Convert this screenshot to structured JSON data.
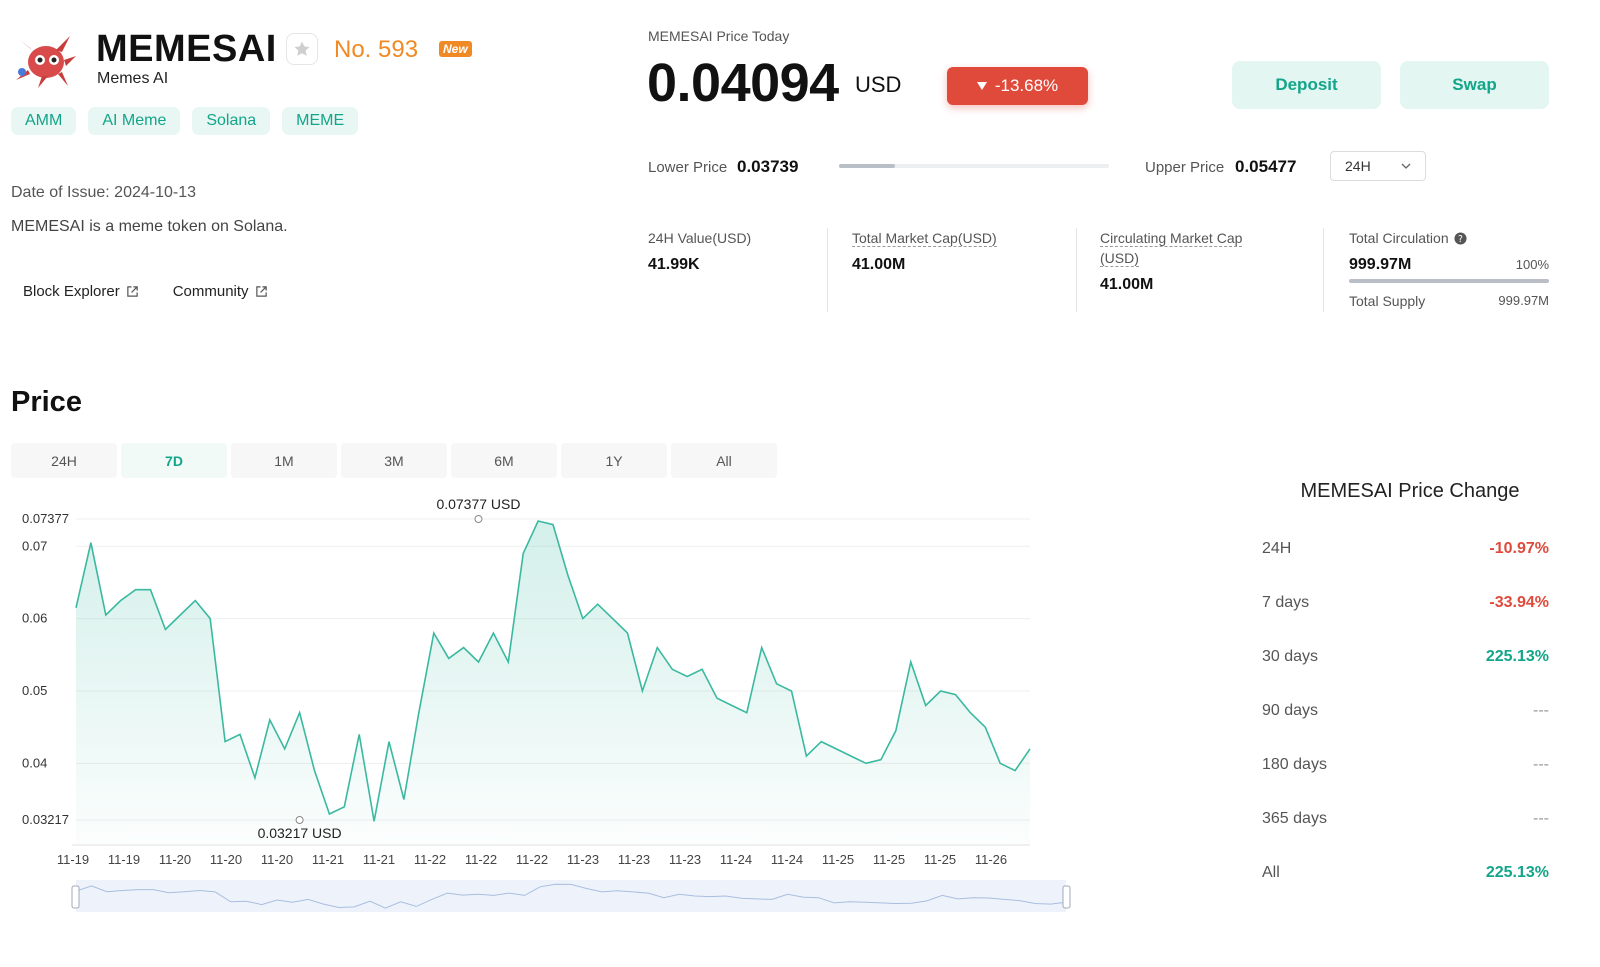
{
  "token": {
    "symbol": "MEMESAI",
    "full_name": "Memes AI",
    "rank": "No. 593",
    "new_badge": "New",
    "tags": [
      "AMM",
      "AI Meme",
      "Solana",
      "MEME"
    ],
    "issue_date": "Date of Issue: 2024-10-13",
    "description": "MEMESAI is a meme token on Solana.",
    "links": [
      "Block Explorer",
      "Community"
    ]
  },
  "price_header": {
    "label": "MEMESAI Price Today",
    "price": "0.04094",
    "unit": "USD",
    "change": "-13.68%",
    "deposit_label": "Deposit",
    "swap_label": "Swap",
    "lower_label": "Lower Price",
    "lower_value": "0.03739",
    "upper_label": "Upper Price",
    "upper_value": "0.05477",
    "period": "24H"
  },
  "stats": {
    "value_24h_label": "24H Value(USD)",
    "value_24h": "41.99K",
    "mcap_label": "Total Market Cap(USD)",
    "mcap": "41.00M",
    "circ_mcap_label_1": "Circulating Market Cap",
    "circ_mcap_label_2": "(USD)",
    "circ_mcap": "41.00M",
    "total_circ_label": "Total Circulation",
    "total_circ": "999.97M",
    "total_circ_pct": "100%",
    "total_supply_label": "Total Supply",
    "total_supply": "999.97M"
  },
  "price_section": {
    "heading": "Price",
    "tabs": [
      "24H",
      "7D",
      "1M",
      "3M",
      "6M",
      "1Y",
      "All"
    ],
    "active_tab": "7D"
  },
  "chart_data": {
    "type": "area",
    "ylim": [
      0.03217,
      0.07377
    ],
    "yticks": [
      "0.07377",
      "0.07",
      "0.06",
      "0.05",
      "0.04",
      "0.03217"
    ],
    "xtick_labels": [
      "11-19",
      "11-19",
      "11-20",
      "11-20",
      "11-20",
      "11-21",
      "11-21",
      "11-22",
      "11-22",
      "11-22",
      "11-23",
      "11-23",
      "11-23",
      "11-24",
      "11-24",
      "11-25",
      "11-25",
      "11-25",
      "11-26"
    ],
    "max_label": "0.07377 USD",
    "min_label": "0.03217 USD",
    "max_index": 27,
    "min_index": 15,
    "values": [
      0.0615,
      0.0705,
      0.0605,
      0.0625,
      0.064,
      0.064,
      0.0585,
      0.0605,
      0.0625,
      0.06,
      0.043,
      0.044,
      0.038,
      0.046,
      0.042,
      0.047,
      0.039,
      0.033,
      0.034,
      0.044,
      0.032,
      0.043,
      0.035,
      0.047,
      0.058,
      0.0545,
      0.056,
      0.054,
      0.058,
      0.054,
      0.069,
      0.0735,
      0.073,
      0.066,
      0.06,
      0.062,
      0.06,
      0.058,
      0.05,
      0.056,
      0.053,
      0.052,
      0.053,
      0.049,
      0.048,
      0.047,
      0.056,
      0.051,
      0.05,
      0.041,
      0.043,
      0.042,
      0.041,
      0.04,
      0.0405,
      0.0445,
      0.054,
      0.048,
      0.05,
      0.0495,
      0.047,
      0.045,
      0.04,
      0.039,
      0.042
    ]
  },
  "price_change": {
    "title": "MEMESAI Price Change",
    "rows": [
      {
        "label": "24H",
        "value": "-10.97%"
      },
      {
        "label": "7 days",
        "value": "-33.94%"
      },
      {
        "label": "30 days",
        "value": "225.13%"
      },
      {
        "label": "90 days",
        "value": "---"
      },
      {
        "label": "180 days",
        "value": "---"
      },
      {
        "label": "365 days",
        "value": "---"
      },
      {
        "label": "All",
        "value": "225.13%"
      }
    ]
  },
  "colors": {
    "accent": "#13a58a",
    "negative": "#e04a3b",
    "rank": "#f08a24",
    "chart_line": "#3ab9a0"
  }
}
